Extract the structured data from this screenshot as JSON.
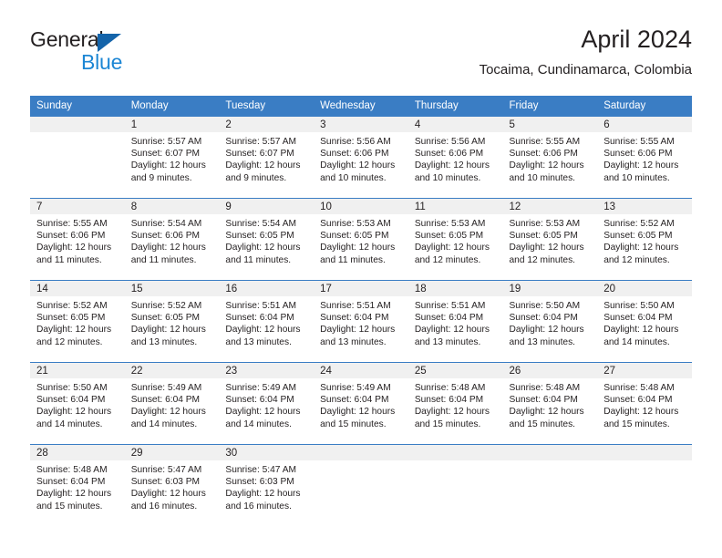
{
  "brand": {
    "name_part1": "General",
    "name_part2": "Blue",
    "accent_color": "#1c86d4",
    "triangle_color": "#1464aa"
  },
  "header": {
    "title": "April 2024",
    "subtitle": "Tocaima, Cundinamarca, Colombia"
  },
  "calendar": {
    "header_bg": "#3a7dc4",
    "daynum_bg": "#f0f0f0",
    "weekdays": [
      "Sunday",
      "Monday",
      "Tuesday",
      "Wednesday",
      "Thursday",
      "Friday",
      "Saturday"
    ],
    "weeks": [
      [
        {
          "day": "",
          "sunrise": "",
          "sunset": "",
          "daylight1": "",
          "daylight2": ""
        },
        {
          "day": "1",
          "sunrise": "Sunrise: 5:57 AM",
          "sunset": "Sunset: 6:07 PM",
          "daylight1": "Daylight: 12 hours",
          "daylight2": "and 9 minutes."
        },
        {
          "day": "2",
          "sunrise": "Sunrise: 5:57 AM",
          "sunset": "Sunset: 6:07 PM",
          "daylight1": "Daylight: 12 hours",
          "daylight2": "and 9 minutes."
        },
        {
          "day": "3",
          "sunrise": "Sunrise: 5:56 AM",
          "sunset": "Sunset: 6:06 PM",
          "daylight1": "Daylight: 12 hours",
          "daylight2": "and 10 minutes."
        },
        {
          "day": "4",
          "sunrise": "Sunrise: 5:56 AM",
          "sunset": "Sunset: 6:06 PM",
          "daylight1": "Daylight: 12 hours",
          "daylight2": "and 10 minutes."
        },
        {
          "day": "5",
          "sunrise": "Sunrise: 5:55 AM",
          "sunset": "Sunset: 6:06 PM",
          "daylight1": "Daylight: 12 hours",
          "daylight2": "and 10 minutes."
        },
        {
          "day": "6",
          "sunrise": "Sunrise: 5:55 AM",
          "sunset": "Sunset: 6:06 PM",
          "daylight1": "Daylight: 12 hours",
          "daylight2": "and 10 minutes."
        }
      ],
      [
        {
          "day": "7",
          "sunrise": "Sunrise: 5:55 AM",
          "sunset": "Sunset: 6:06 PM",
          "daylight1": "Daylight: 12 hours",
          "daylight2": "and 11 minutes."
        },
        {
          "day": "8",
          "sunrise": "Sunrise: 5:54 AM",
          "sunset": "Sunset: 6:06 PM",
          "daylight1": "Daylight: 12 hours",
          "daylight2": "and 11 minutes."
        },
        {
          "day": "9",
          "sunrise": "Sunrise: 5:54 AM",
          "sunset": "Sunset: 6:05 PM",
          "daylight1": "Daylight: 12 hours",
          "daylight2": "and 11 minutes."
        },
        {
          "day": "10",
          "sunrise": "Sunrise: 5:53 AM",
          "sunset": "Sunset: 6:05 PM",
          "daylight1": "Daylight: 12 hours",
          "daylight2": "and 11 minutes."
        },
        {
          "day": "11",
          "sunrise": "Sunrise: 5:53 AM",
          "sunset": "Sunset: 6:05 PM",
          "daylight1": "Daylight: 12 hours",
          "daylight2": "and 12 minutes."
        },
        {
          "day": "12",
          "sunrise": "Sunrise: 5:53 AM",
          "sunset": "Sunset: 6:05 PM",
          "daylight1": "Daylight: 12 hours",
          "daylight2": "and 12 minutes."
        },
        {
          "day": "13",
          "sunrise": "Sunrise: 5:52 AM",
          "sunset": "Sunset: 6:05 PM",
          "daylight1": "Daylight: 12 hours",
          "daylight2": "and 12 minutes."
        }
      ],
      [
        {
          "day": "14",
          "sunrise": "Sunrise: 5:52 AM",
          "sunset": "Sunset: 6:05 PM",
          "daylight1": "Daylight: 12 hours",
          "daylight2": "and 12 minutes."
        },
        {
          "day": "15",
          "sunrise": "Sunrise: 5:52 AM",
          "sunset": "Sunset: 6:05 PM",
          "daylight1": "Daylight: 12 hours",
          "daylight2": "and 13 minutes."
        },
        {
          "day": "16",
          "sunrise": "Sunrise: 5:51 AM",
          "sunset": "Sunset: 6:04 PM",
          "daylight1": "Daylight: 12 hours",
          "daylight2": "and 13 minutes."
        },
        {
          "day": "17",
          "sunrise": "Sunrise: 5:51 AM",
          "sunset": "Sunset: 6:04 PM",
          "daylight1": "Daylight: 12 hours",
          "daylight2": "and 13 minutes."
        },
        {
          "day": "18",
          "sunrise": "Sunrise: 5:51 AM",
          "sunset": "Sunset: 6:04 PM",
          "daylight1": "Daylight: 12 hours",
          "daylight2": "and 13 minutes."
        },
        {
          "day": "19",
          "sunrise": "Sunrise: 5:50 AM",
          "sunset": "Sunset: 6:04 PM",
          "daylight1": "Daylight: 12 hours",
          "daylight2": "and 13 minutes."
        },
        {
          "day": "20",
          "sunrise": "Sunrise: 5:50 AM",
          "sunset": "Sunset: 6:04 PM",
          "daylight1": "Daylight: 12 hours",
          "daylight2": "and 14 minutes."
        }
      ],
      [
        {
          "day": "21",
          "sunrise": "Sunrise: 5:50 AM",
          "sunset": "Sunset: 6:04 PM",
          "daylight1": "Daylight: 12 hours",
          "daylight2": "and 14 minutes."
        },
        {
          "day": "22",
          "sunrise": "Sunrise: 5:49 AM",
          "sunset": "Sunset: 6:04 PM",
          "daylight1": "Daylight: 12 hours",
          "daylight2": "and 14 minutes."
        },
        {
          "day": "23",
          "sunrise": "Sunrise: 5:49 AM",
          "sunset": "Sunset: 6:04 PM",
          "daylight1": "Daylight: 12 hours",
          "daylight2": "and 14 minutes."
        },
        {
          "day": "24",
          "sunrise": "Sunrise: 5:49 AM",
          "sunset": "Sunset: 6:04 PM",
          "daylight1": "Daylight: 12 hours",
          "daylight2": "and 15 minutes."
        },
        {
          "day": "25",
          "sunrise": "Sunrise: 5:48 AM",
          "sunset": "Sunset: 6:04 PM",
          "daylight1": "Daylight: 12 hours",
          "daylight2": "and 15 minutes."
        },
        {
          "day": "26",
          "sunrise": "Sunrise: 5:48 AM",
          "sunset": "Sunset: 6:04 PM",
          "daylight1": "Daylight: 12 hours",
          "daylight2": "and 15 minutes."
        },
        {
          "day": "27",
          "sunrise": "Sunrise: 5:48 AM",
          "sunset": "Sunset: 6:04 PM",
          "daylight1": "Daylight: 12 hours",
          "daylight2": "and 15 minutes."
        }
      ],
      [
        {
          "day": "28",
          "sunrise": "Sunrise: 5:48 AM",
          "sunset": "Sunset: 6:04 PM",
          "daylight1": "Daylight: 12 hours",
          "daylight2": "and 15 minutes."
        },
        {
          "day": "29",
          "sunrise": "Sunrise: 5:47 AM",
          "sunset": "Sunset: 6:03 PM",
          "daylight1": "Daylight: 12 hours",
          "daylight2": "and 16 minutes."
        },
        {
          "day": "30",
          "sunrise": "Sunrise: 5:47 AM",
          "sunset": "Sunset: 6:03 PM",
          "daylight1": "Daylight: 12 hours",
          "daylight2": "and 16 minutes."
        },
        {
          "day": "",
          "sunrise": "",
          "sunset": "",
          "daylight1": "",
          "daylight2": ""
        },
        {
          "day": "",
          "sunrise": "",
          "sunset": "",
          "daylight1": "",
          "daylight2": ""
        },
        {
          "day": "",
          "sunrise": "",
          "sunset": "",
          "daylight1": "",
          "daylight2": ""
        },
        {
          "day": "",
          "sunrise": "",
          "sunset": "",
          "daylight1": "",
          "daylight2": ""
        }
      ]
    ]
  }
}
